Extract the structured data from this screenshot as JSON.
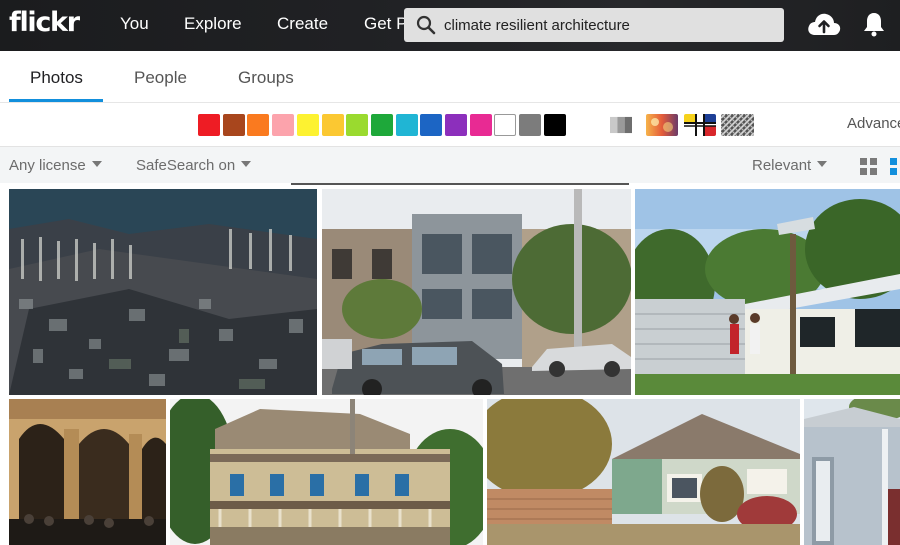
{
  "brand": {
    "logo_text": "flickr"
  },
  "nav": {
    "you": "You",
    "explore": "Explore",
    "create": "Create",
    "get_pro": "Get Pro"
  },
  "search": {
    "value": "climate resilient architecture"
  },
  "icons": {
    "search": "search-icon",
    "upload": "cloud-upload-icon",
    "notifications": "bell-icon",
    "grid_view": "grid-icon"
  },
  "tabs": [
    {
      "label": "Photos",
      "active": true
    },
    {
      "label": "People",
      "active": false
    },
    {
      "label": "Groups",
      "active": false
    }
  ],
  "color_swatches": [
    "#ee1c24",
    "#a8461d",
    "#fa7a1f",
    "#fca3ac",
    "#fdf231",
    "#fbc832",
    "#9ada2f",
    "#1ea83a",
    "#20b5d4",
    "#1c65c4",
    "#8c2fbc",
    "#e82a93",
    "#ffffff",
    "#7c7c7c",
    "#000000"
  ],
  "style_filters": [
    "black-and-white",
    "shallow-depth-of-field",
    "minimalist",
    "patterns"
  ],
  "advanced_label": "Advance",
  "filters": {
    "license": "Any license",
    "safesearch": "SafeSearch on",
    "sort": "Relevant"
  },
  "colors": {
    "accent": "#128fdc",
    "topbar": "#202124"
  }
}
